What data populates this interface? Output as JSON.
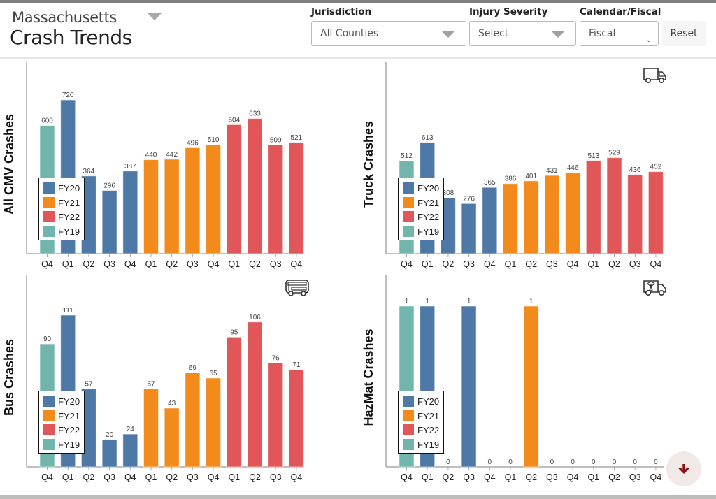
{
  "header": {
    "state": "Massachusetts",
    "title": "Crash Trends",
    "filters": {
      "jurisdiction": {
        "label": "Jurisdiction",
        "value": "All Counties"
      },
      "injury_severity": {
        "label": "Injury Severity",
        "value": "Select"
      },
      "calendar_fiscal": {
        "label": "Calendar/Fiscal",
        "value": "Fiscal"
      }
    },
    "reset_label": "Reset"
  },
  "colors": {
    "FY19": "#72b5ad",
    "FY20": "#4e79a7",
    "FY21": "#f28a1c",
    "FY22": "#e15759"
  },
  "legend": [
    "FY20",
    "FY21",
    "FY22",
    "FY19"
  ],
  "scroll_down_icon": "arrow-down-icon",
  "chart_data": [
    {
      "type": "bar",
      "id": "cmv",
      "title": "",
      "ylabel": "All CMV Crashes",
      "icon": "none",
      "categories": [
        "Q4",
        "Q1",
        "Q2",
        "Q3",
        "Q4",
        "Q1",
        "Q2",
        "Q3",
        "Q4",
        "Q1",
        "Q2",
        "Q3",
        "Q4"
      ],
      "fiscal_years": [
        "FY19",
        "FY20",
        "FY20",
        "FY20",
        "FY20",
        "FY21",
        "FY21",
        "FY21",
        "FY21",
        "FY22",
        "FY22",
        "FY22",
        "FY22"
      ],
      "values": [
        600,
        720,
        364,
        296,
        387,
        440,
        442,
        496,
        510,
        604,
        633,
        509,
        521
      ],
      "ylim": [
        0,
        720
      ],
      "legend_position": "bottom-left"
    },
    {
      "type": "bar",
      "id": "truck",
      "title": "",
      "ylabel": "Truck Crashes",
      "icon": "truck-icon",
      "categories": [
        "Q4",
        "Q1",
        "Q2",
        "Q3",
        "Q4",
        "Q1",
        "Q2",
        "Q3",
        "Q4",
        "Q1",
        "Q2",
        "Q3",
        "Q4"
      ],
      "fiscal_years": [
        "FY19",
        "FY20",
        "FY20",
        "FY20",
        "FY20",
        "FY21",
        "FY21",
        "FY21",
        "FY21",
        "FY22",
        "FY22",
        "FY22",
        "FY22"
      ],
      "values": [
        512,
        613,
        308,
        276,
        365,
        386,
        401,
        431,
        446,
        513,
        529,
        436,
        452
      ],
      "ylim": [
        0,
        720
      ],
      "legend_position": "bottom-left"
    },
    {
      "type": "bar",
      "id": "bus",
      "title": "",
      "ylabel": "Bus Crashes",
      "icon": "bus-icon",
      "categories": [
        "Q4",
        "Q1",
        "Q2",
        "Q3",
        "Q4",
        "Q1",
        "Q2",
        "Q3",
        "Q4",
        "Q1",
        "Q2",
        "Q3",
        "Q4"
      ],
      "fiscal_years": [
        "FY19",
        "FY20",
        "FY20",
        "FY20",
        "FY20",
        "FY21",
        "FY21",
        "FY21",
        "FY21",
        "FY22",
        "FY22",
        "FY22",
        "FY22"
      ],
      "values": [
        90,
        111,
        57,
        20,
        24,
        57,
        43,
        69,
        65,
        95,
        106,
        76,
        71
      ],
      "ylim": [
        0,
        111
      ],
      "legend_position": "bottom-left"
    },
    {
      "type": "bar",
      "id": "hazmat",
      "title": "",
      "ylabel": "HazMat Crashes",
      "icon": "hazmat-truck-icon",
      "categories": [
        "Q4",
        "Q1",
        "Q2",
        "Q3",
        "Q4",
        "Q1",
        "Q2",
        "Q3",
        "Q4",
        "Q1",
        "Q2",
        "Q3",
        "Q4"
      ],
      "fiscal_years": [
        "FY19",
        "FY20",
        "FY20",
        "FY20",
        "FY20",
        "FY21",
        "FY21",
        "FY21",
        "FY21",
        "FY22",
        "FY22",
        "FY22",
        "FY22"
      ],
      "values": [
        1,
        1,
        0,
        1,
        0,
        0,
        1,
        0,
        0,
        0,
        0,
        0,
        0
      ],
      "ylim": [
        0,
        1
      ],
      "legend_position": "bottom-left"
    }
  ]
}
